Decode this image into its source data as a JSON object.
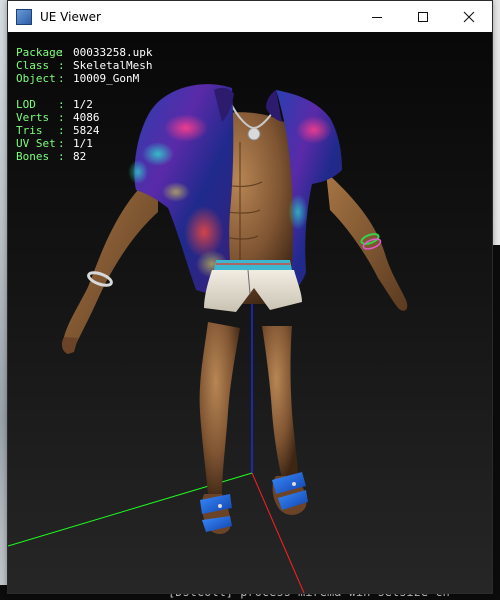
{
  "window": {
    "title": "UE Viewer",
    "minimize_label": "Minimize",
    "maximize_label": "Maximize",
    "close_label": "Close"
  },
  "info": {
    "package": {
      "key": "Package",
      "value": "00033258.upk"
    },
    "class": {
      "key": "Class",
      "value": "SkeletalMesh"
    },
    "object": {
      "key": "Object",
      "value": "10009_GonM"
    },
    "lod": {
      "key": "LOD",
      "value": "1/2"
    },
    "verts": {
      "key": "Verts",
      "value": "4086"
    },
    "tris": {
      "key": "Tris",
      "value": "5824"
    },
    "uvset": {
      "key": "UV Set",
      "value": "1/1"
    },
    "bones": {
      "key": "Bones",
      "value": "82"
    }
  },
  "console": {
    "bottom_line": "[DstColl] process  mirema win setsize  ch"
  },
  "colors": {
    "hud_label": "#7cff7c",
    "hud_value": "#ffffff",
    "axis_x": "#ff2020",
    "axis_y": "#20ff20",
    "axis_z": "#2030ff"
  }
}
